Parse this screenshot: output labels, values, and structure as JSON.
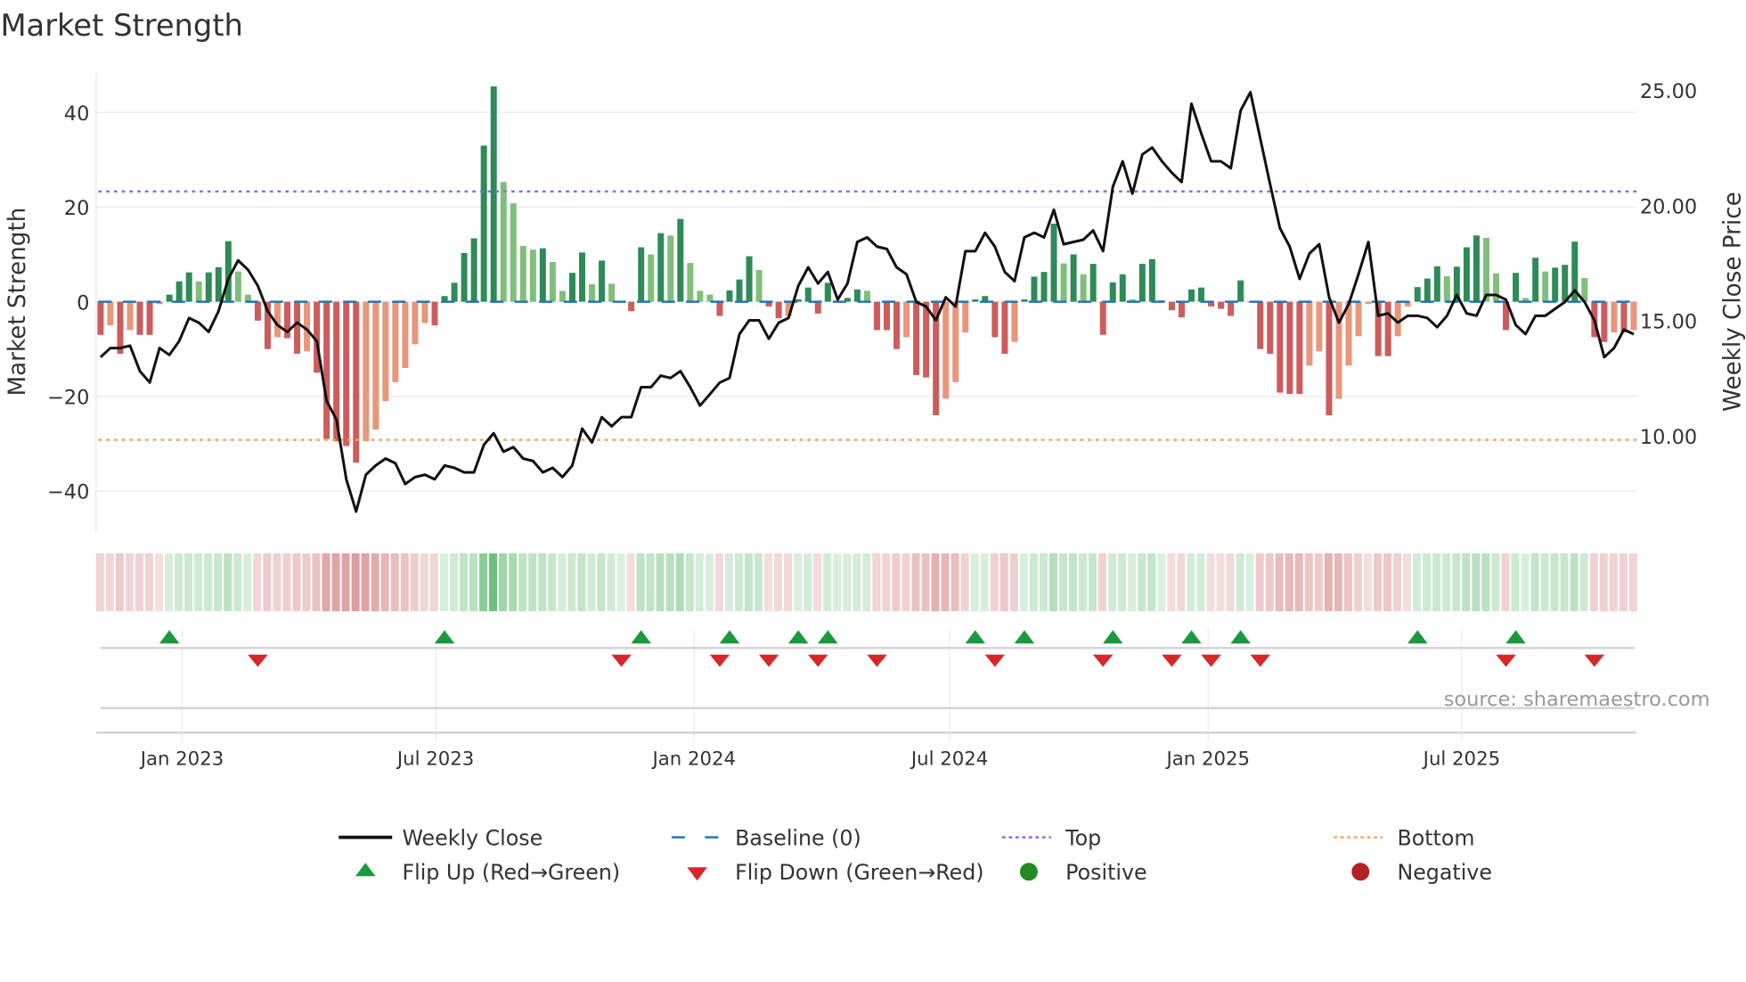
{
  "title": "Market Strength",
  "source": "source: sharemaestro.com",
  "chart_data": {
    "type": "bar",
    "title": "Market Strength",
    "ylabel": "Market Strength",
    "y2label": "Weekly Close Price",
    "ylim": [
      -49,
      49
    ],
    "y2lim": [
      5.5,
      28.2
    ],
    "yticks": [
      {
        "v": 40,
        "label": "40"
      },
      {
        "v": 20,
        "label": "20"
      },
      {
        "v": 0,
        "label": "0"
      },
      {
        "v": -20,
        "label": "−20"
      },
      {
        "v": -40,
        "label": "−40"
      }
    ],
    "y2ticks": [
      {
        "v": 25,
        "label": "25.00"
      },
      {
        "v": 20,
        "label": "20.00"
      },
      {
        "v": 15,
        "label": "15.00"
      },
      {
        "v": 10,
        "label": "10.00"
      }
    ],
    "xticks": [
      {
        "week": 8.3,
        "label": "Jan 2023"
      },
      {
        "week": 34.1,
        "label": "Jul 2023"
      },
      {
        "week": 60.4,
        "label": "Jan 2024"
      },
      {
        "week": 86.4,
        "label": "Jul 2024"
      },
      {
        "week": 112.7,
        "label": "Jan 2025"
      },
      {
        "week": 138.5,
        "label": "Jul 2025"
      }
    ],
    "top_level": 23.3,
    "bottom_level": -29.2,
    "baseline": 0,
    "strength": [
      -7,
      -5,
      -11,
      -6,
      -7,
      -7,
      -0.5,
      1.5,
      4.3,
      6.2,
      4.3,
      6.2,
      7.3,
      12.8,
      6.4,
      1.5,
      -4,
      -10,
      -7.5,
      -7.7,
      -11,
      -10.5,
      -15,
      -29,
      -29.5,
      -30.5,
      -34,
      -29.5,
      -27,
      -21,
      -17,
      -14,
      -9,
      -4.5,
      -5,
      1.2,
      4,
      10.3,
      13.4,
      33,
      45.5,
      25.3,
      20.8,
      11.8,
      11,
      11.3,
      8.4,
      2.3,
      6.1,
      10.4,
      3.7,
      8.7,
      3.8,
      0,
      -2,
      11.5,
      10,
      14.5,
      14,
      17.5,
      8.2,
      2.3,
      1.5,
      -3,
      2.4,
      4.7,
      9.6,
      6.7,
      -1,
      -3.5,
      -3,
      0.5,
      3,
      -2.5,
      4,
      0,
      0.8,
      2.6,
      2.3,
      -6,
      -6,
      -10,
      -7.5,
      -15.5,
      -16,
      -24,
      -20.5,
      -17,
      -6.5,
      0.5,
      1.2,
      -7.5,
      -11,
      -8.5,
      0.5,
      5.3,
      6.3,
      16.5,
      8.1,
      10,
      5.8,
      8,
      -7,
      4.1,
      5.8,
      0.5,
      8,
      9,
      0.3,
      -1.8,
      -3.3,
      2.6,
      3,
      -1,
      -1.5,
      -3,
      4.5,
      0,
      -10,
      -11,
      -19.2,
      -19.5,
      -19.5,
      -13.5,
      -10.5,
      -24,
      -20.5,
      -13.5,
      -7.3,
      -0.5,
      -11.5,
      -11.5,
      -7.3,
      -1,
      3.1,
      4.9,
      7.5,
      5.4,
      7.4,
      11.5,
      14,
      13.5,
      6,
      -6,
      6.1,
      0.8,
      9.3,
      6.4,
      7.2,
      7.8,
      12.7,
      5,
      -7.5,
      -8.5,
      -6.5,
      -6.5,
      -6
    ],
    "weekly_close": [
      13.8,
      14.2,
      14.2,
      14.3,
      13.2,
      12.7,
      14.2,
      13.9,
      14.5,
      15.5,
      15.3,
      14.9,
      15.8,
      17.2,
      18.0,
      17.6,
      16.9,
      15.8,
      15.2,
      14.9,
      15.3,
      15.0,
      14.5,
      11.9,
      11.1,
      8.5,
      7.1,
      8.7,
      9.1,
      9.4,
      9.2,
      8.3,
      8.6,
      8.7,
      8.5,
      9.1,
      9.0,
      8.8,
      8.8,
      10.0,
      10.5,
      9.7,
      9.9,
      9.4,
      9.3,
      8.8,
      9.0,
      8.6,
      9.1,
      10.7,
      10.1,
      11.2,
      10.8,
      11.2,
      11.2,
      12.5,
      12.5,
      13.0,
      12.9,
      13.2,
      12.5,
      11.7,
      12.2,
      12.7,
      12.9,
      14.8,
      15.4,
      15.4,
      14.6,
      15.3,
      15.5,
      16.9,
      17.7,
      17.0,
      17.5,
      16.3,
      17.0,
      18.8,
      19.0,
      18.6,
      18.5,
      17.7,
      17.4,
      16.2,
      16.0,
      15.4,
      16.4,
      16.0,
      18.4,
      18.4,
      19.2,
      18.6,
      17.5,
      17.1,
      19.0,
      19.2,
      19.0,
      20.2,
      18.7,
      18.8,
      18.9,
      19.3,
      18.4,
      21.2,
      22.3,
      20.9,
      22.6,
      22.9,
      22.3,
      21.8,
      21.4,
      24.8,
      23.5,
      22.3,
      22.3,
      22.0,
      24.5,
      25.3,
      23.3,
      21.3,
      19.4,
      18.6,
      17.2,
      18.3,
      18.7,
      16.4,
      15.3,
      16.1,
      17.4,
      18.8,
      15.6,
      15.7,
      15.3,
      15.6,
      15.6,
      15.5,
      15.1,
      15.6,
      16.5,
      15.7,
      15.6,
      16.5,
      16.5,
      16.3,
      15.2,
      14.8,
      15.6,
      15.6,
      15.9,
      16.2,
      16.7,
      16.2,
      15.4,
      13.8,
      14.2,
      15.0,
      14.8
    ],
    "flip_up_weeks": [
      7,
      35,
      55,
      64,
      71,
      74,
      89,
      94,
      103,
      111,
      116,
      134,
      144
    ],
    "flip_down_weeks": [
      16,
      53,
      63,
      68,
      73,
      79,
      91,
      102,
      109,
      113,
      118,
      143,
      152
    ],
    "legend": {
      "placement": "bottom",
      "items": [
        {
          "key": "close",
          "label": "Weekly Close"
        },
        {
          "key": "baseline",
          "label": "Baseline (0)"
        },
        {
          "key": "top",
          "label": "Top"
        },
        {
          "key": "bottom",
          "label": "Bottom"
        },
        {
          "key": "flip_up",
          "label": "Flip Up (Red→Green)"
        },
        {
          "key": "flip_down",
          "label": "Flip Down (Green→Red)"
        },
        {
          "key": "positive",
          "label": "Positive"
        },
        {
          "key": "negative",
          "label": "Negative"
        }
      ]
    },
    "colors": {
      "pos_strong": "#2e8b57",
      "pos_weak": "#7fbf7b",
      "neg_strong": "#cd5c5c",
      "neg_weak": "#e9967a",
      "close": "#111111",
      "baseline": "#1f77b4",
      "top": "#9467dd",
      "bottom": "#f4a460",
      "flip_up": "#1a9a3c",
      "flip_down": "#d62728",
      "positive": "#228b22",
      "negative": "#b22222"
    }
  }
}
